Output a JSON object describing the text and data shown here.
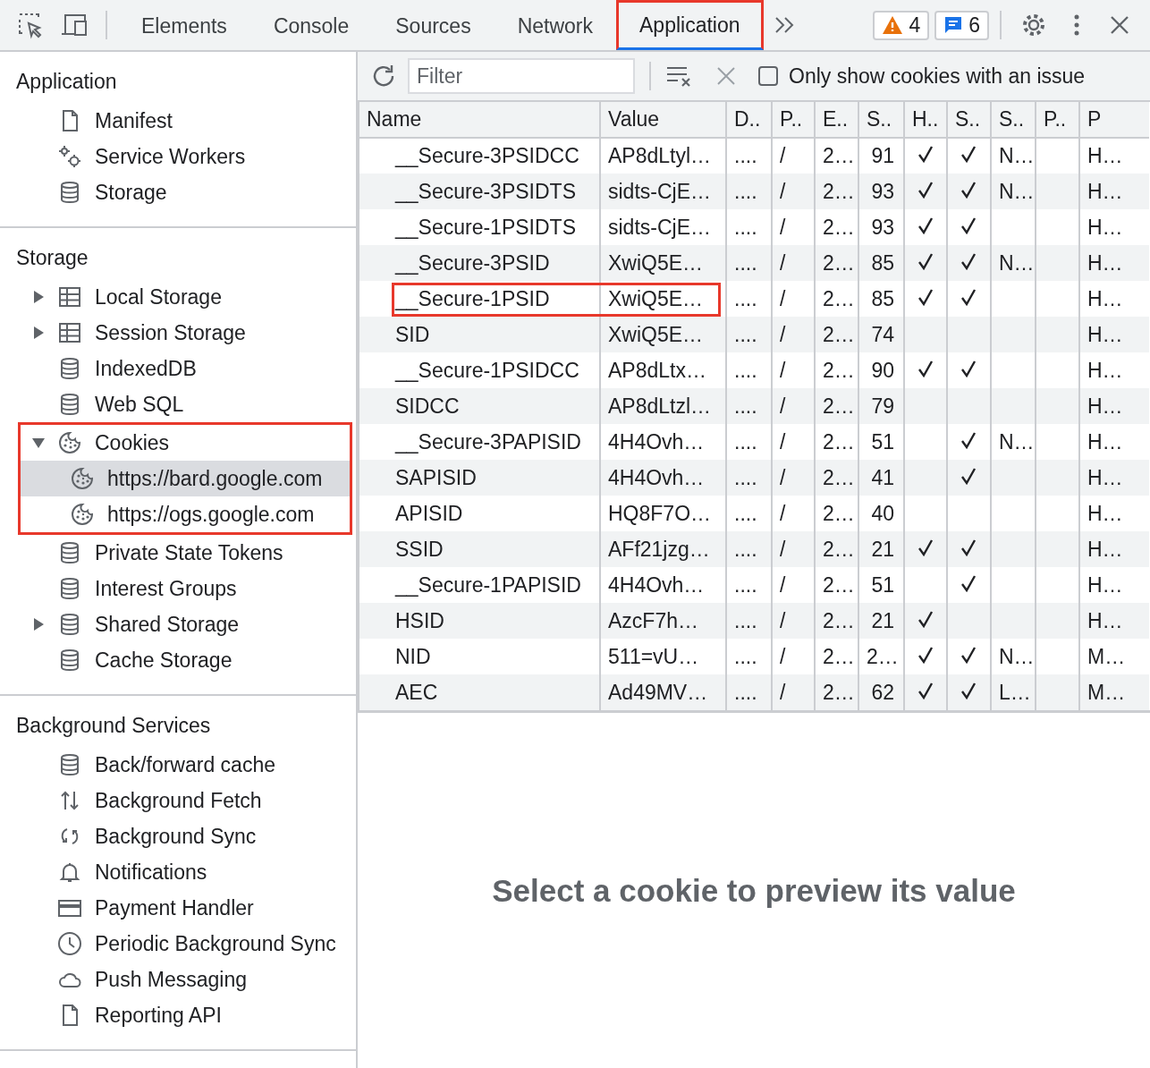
{
  "toolbar": {
    "tabs": [
      {
        "label": "Elements",
        "selected": false,
        "highlighted": false
      },
      {
        "label": "Console",
        "selected": false,
        "highlighted": false
      },
      {
        "label": "Sources",
        "selected": false,
        "highlighted": false
      },
      {
        "label": "Network",
        "selected": false,
        "highlighted": false
      },
      {
        "label": "Application",
        "selected": true,
        "highlighted": true
      }
    ],
    "warnings": "4",
    "messages": "6"
  },
  "sidebar": {
    "sections": [
      {
        "title": "Application",
        "items": [
          {
            "label": "Manifest",
            "kind": "document",
            "selected": false
          },
          {
            "label": "Service Workers",
            "kind": "gears",
            "selected": false
          },
          {
            "label": "Storage",
            "kind": "database",
            "selected": false
          }
        ]
      },
      {
        "title": "Storage",
        "items": [
          {
            "label": "Local Storage",
            "kind": "table",
            "selected": false,
            "expanded": false
          },
          {
            "label": "Session Storage",
            "kind": "table",
            "selected": false,
            "expanded": false
          },
          {
            "label": "IndexedDB",
            "kind": "database",
            "selected": false
          },
          {
            "label": "Web SQL",
            "kind": "database",
            "selected": false
          },
          {
            "label": "Cookies",
            "kind": "cookie",
            "selected": false,
            "expanded": true,
            "highlighted": true,
            "children": [
              {
                "label": "https://bard.google.com",
                "kind": "cookie",
                "selected": true
              },
              {
                "label": "https://ogs.google.com",
                "kind": "cookie",
                "selected": false
              }
            ]
          },
          {
            "label": "Private State Tokens",
            "kind": "database",
            "selected": false
          },
          {
            "label": "Interest Groups",
            "kind": "database",
            "selected": false
          },
          {
            "label": "Shared Storage",
            "kind": "database",
            "selected": false,
            "expanded": false
          },
          {
            "label": "Cache Storage",
            "kind": "database",
            "selected": false
          }
        ]
      },
      {
        "title": "Background Services",
        "items": [
          {
            "label": "Back/forward cache",
            "kind": "database",
            "selected": false
          },
          {
            "label": "Background Fetch",
            "kind": "arrows",
            "selected": false
          },
          {
            "label": "Background Sync",
            "kind": "sync",
            "selected": false
          },
          {
            "label": "Notifications",
            "kind": "bell",
            "selected": false
          },
          {
            "label": "Payment Handler",
            "kind": "card",
            "selected": false
          },
          {
            "label": "Periodic Background Sync",
            "kind": "clock",
            "selected": false
          },
          {
            "label": "Push Messaging",
            "kind": "cloud",
            "selected": false
          },
          {
            "label": "Reporting API",
            "kind": "document",
            "selected": false
          }
        ]
      }
    ]
  },
  "filter": {
    "placeholder": "Filter",
    "only_issues": {
      "label": "Only show cookies with an issue",
      "checked": false
    }
  },
  "table": {
    "columns": [
      "Name",
      "Value",
      "D..",
      "P..",
      "E..",
      "S..",
      "H..",
      "S..",
      "S..",
      "P..",
      "P"
    ],
    "rows": [
      {
        "name": "__Secure-3PSIDCC",
        "value": "AP8dLtyl…",
        "domain": "....",
        "path": "/",
        "expires": "2…",
        "size": "91",
        "http_only": true,
        "secure": true,
        "same_site": "N…",
        "priority": "H…",
        "highlighted": false
      },
      {
        "name": "__Secure-3PSIDTS",
        "value": "sidts-CjE…",
        "domain": "....",
        "path": "/",
        "expires": "2…",
        "size": "93",
        "http_only": true,
        "secure": true,
        "same_site": "N…",
        "priority": "H…",
        "highlighted": false
      },
      {
        "name": "__Secure-1PSIDTS",
        "value": "sidts-CjE…",
        "domain": "....",
        "path": "/",
        "expires": "2…",
        "size": "93",
        "http_only": true,
        "secure": true,
        "priority": "H…",
        "highlighted": false
      },
      {
        "name": "__Secure-3PSID",
        "value": "XwiQ5E…",
        "domain": "....",
        "path": "/",
        "expires": "2…",
        "size": "85",
        "http_only": true,
        "secure": true,
        "same_site": "N…",
        "priority": "H…",
        "highlighted": false
      },
      {
        "name": "__Secure-1PSID",
        "value": "XwiQ5E…",
        "domain": "....",
        "path": "/",
        "expires": "2…",
        "size": "85",
        "http_only": true,
        "secure": true,
        "priority": "H…",
        "highlighted": true
      },
      {
        "name": "SID",
        "value": "XwiQ5E…",
        "domain": "....",
        "path": "/",
        "expires": "2…",
        "size": "74",
        "http_only": false,
        "secure": false,
        "priority": "H…",
        "highlighted": false
      },
      {
        "name": "__Secure-1PSIDCC",
        "value": "AP8dLtx…",
        "domain": "....",
        "path": "/",
        "expires": "2…",
        "size": "90",
        "http_only": true,
        "secure": true,
        "priority": "H…",
        "highlighted": false
      },
      {
        "name": "SIDCC",
        "value": "AP8dLtzl…",
        "domain": "....",
        "path": "/",
        "expires": "2…",
        "size": "79",
        "http_only": false,
        "secure": false,
        "priority": "H…",
        "highlighted": false
      },
      {
        "name": "__Secure-3PAPISID",
        "value": "4H4Ovh…",
        "domain": "....",
        "path": "/",
        "expires": "2…",
        "size": "51",
        "http_only": false,
        "secure": true,
        "same_site": "N…",
        "priority": "H…",
        "highlighted": false
      },
      {
        "name": "SAPISID",
        "value": "4H4Ovh…",
        "domain": "....",
        "path": "/",
        "expires": "2…",
        "size": "41",
        "http_only": false,
        "secure": true,
        "priority": "H…",
        "highlighted": false
      },
      {
        "name": "APISID",
        "value": "HQ8F7O…",
        "domain": "....",
        "path": "/",
        "expires": "2…",
        "size": "40",
        "http_only": false,
        "secure": false,
        "priority": "H…",
        "highlighted": false
      },
      {
        "name": "SSID",
        "value": "AFf21jzg…",
        "domain": "....",
        "path": "/",
        "expires": "2…",
        "size": "21",
        "http_only": true,
        "secure": true,
        "priority": "H…",
        "highlighted": false
      },
      {
        "name": "__Secure-1PAPISID",
        "value": "4H4Ovh…",
        "domain": "....",
        "path": "/",
        "expires": "2…",
        "size": "51",
        "http_only": false,
        "secure": true,
        "priority": "H…",
        "highlighted": false
      },
      {
        "name": "HSID",
        "value": "AzcF7h…",
        "domain": "....",
        "path": "/",
        "expires": "2…",
        "size": "21",
        "http_only": true,
        "secure": false,
        "priority": "H…",
        "highlighted": false
      },
      {
        "name": "NID",
        "value": "511=vU…",
        "domain": "....",
        "path": "/",
        "expires": "2…",
        "size": "2…",
        "http_only": true,
        "secure": true,
        "same_site": "N…",
        "priority": "M…",
        "highlighted": false
      },
      {
        "name": "AEC",
        "value": "Ad49MV…",
        "domain": "....",
        "path": "/",
        "expires": "2…",
        "size": "62",
        "http_only": true,
        "secure": true,
        "same_site": "L…",
        "priority": "M…",
        "highlighted": false
      }
    ]
  },
  "preview": {
    "message": "Select a cookie to preview its value"
  }
}
